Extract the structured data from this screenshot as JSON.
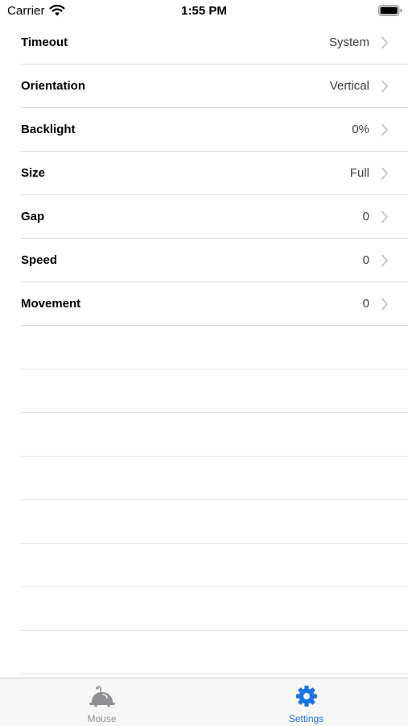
{
  "status_bar": {
    "carrier": "Carrier",
    "time": "1:55 PM"
  },
  "settings": {
    "rows": [
      {
        "label": "Timeout",
        "value": "System"
      },
      {
        "label": "Orientation",
        "value": "Vertical"
      },
      {
        "label": "Backlight",
        "value": "0%"
      },
      {
        "label": "Size",
        "value": "Full"
      },
      {
        "label": "Gap",
        "value": "0"
      },
      {
        "label": "Speed",
        "value": "0"
      },
      {
        "label": "Movement",
        "value": "0"
      }
    ]
  },
  "tab_bar": {
    "tabs": [
      {
        "label": "Mouse",
        "icon": "mouse-icon",
        "selected": false
      },
      {
        "label": "Settings",
        "icon": "gear-icon",
        "selected": true
      }
    ]
  },
  "colors": {
    "accent": "#1a73e8",
    "inactive": "#8e8e93",
    "separator": "#dcdce0"
  }
}
